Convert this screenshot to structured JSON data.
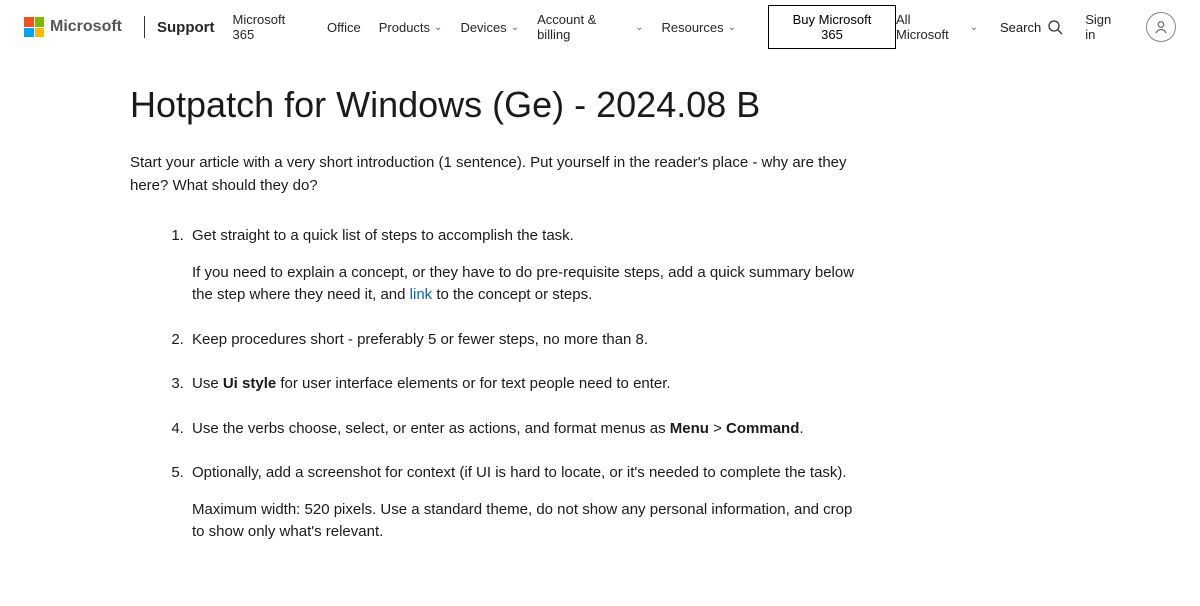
{
  "header": {
    "brand": "Microsoft",
    "nav": {
      "support": "Support",
      "m365": "Microsoft 365",
      "office": "Office",
      "products": "Products",
      "devices": "Devices",
      "account": "Account & billing",
      "resources": "Resources"
    },
    "buy": "Buy Microsoft 365",
    "allms": "All Microsoft",
    "search": "Search",
    "signin": "Sign in"
  },
  "article": {
    "title": "Hotpatch for Windows (Ge) - 2024.08 B",
    "intro": "Start your article with a very short introduction (1 sentence). Put yourself in the reader's place - why are they here? What should they do?",
    "step1_a": "Get straight to a quick list of steps to accomplish the task.",
    "step1_b_pre": "If you need to explain a concept, or they have to do pre-requisite steps, add a quick summary below the step where they need it, and ",
    "step1_link": "link",
    "step1_b_post": " to the concept or steps.",
    "step2": "Keep procedures short - preferably 5 or fewer steps, no more than 8.",
    "step3_pre": "Use ",
    "step3_bold": "Ui style",
    "step3_post": " for user interface elements or for text people need to enter.",
    "step4_pre": "Use the verbs choose, select, or enter as actions, and format menus as ",
    "step4_menu": "Menu",
    "step4_gt": " > ",
    "step4_cmd": "Command",
    "step4_post": ".",
    "step5_a": "Optionally, add a screenshot for context (if UI is hard to locate, or it's needed to complete the task).",
    "step5_b": "Maximum width: 520 pixels. Use a standard theme, do not show any personal information, and crop to show only what's relevant."
  }
}
